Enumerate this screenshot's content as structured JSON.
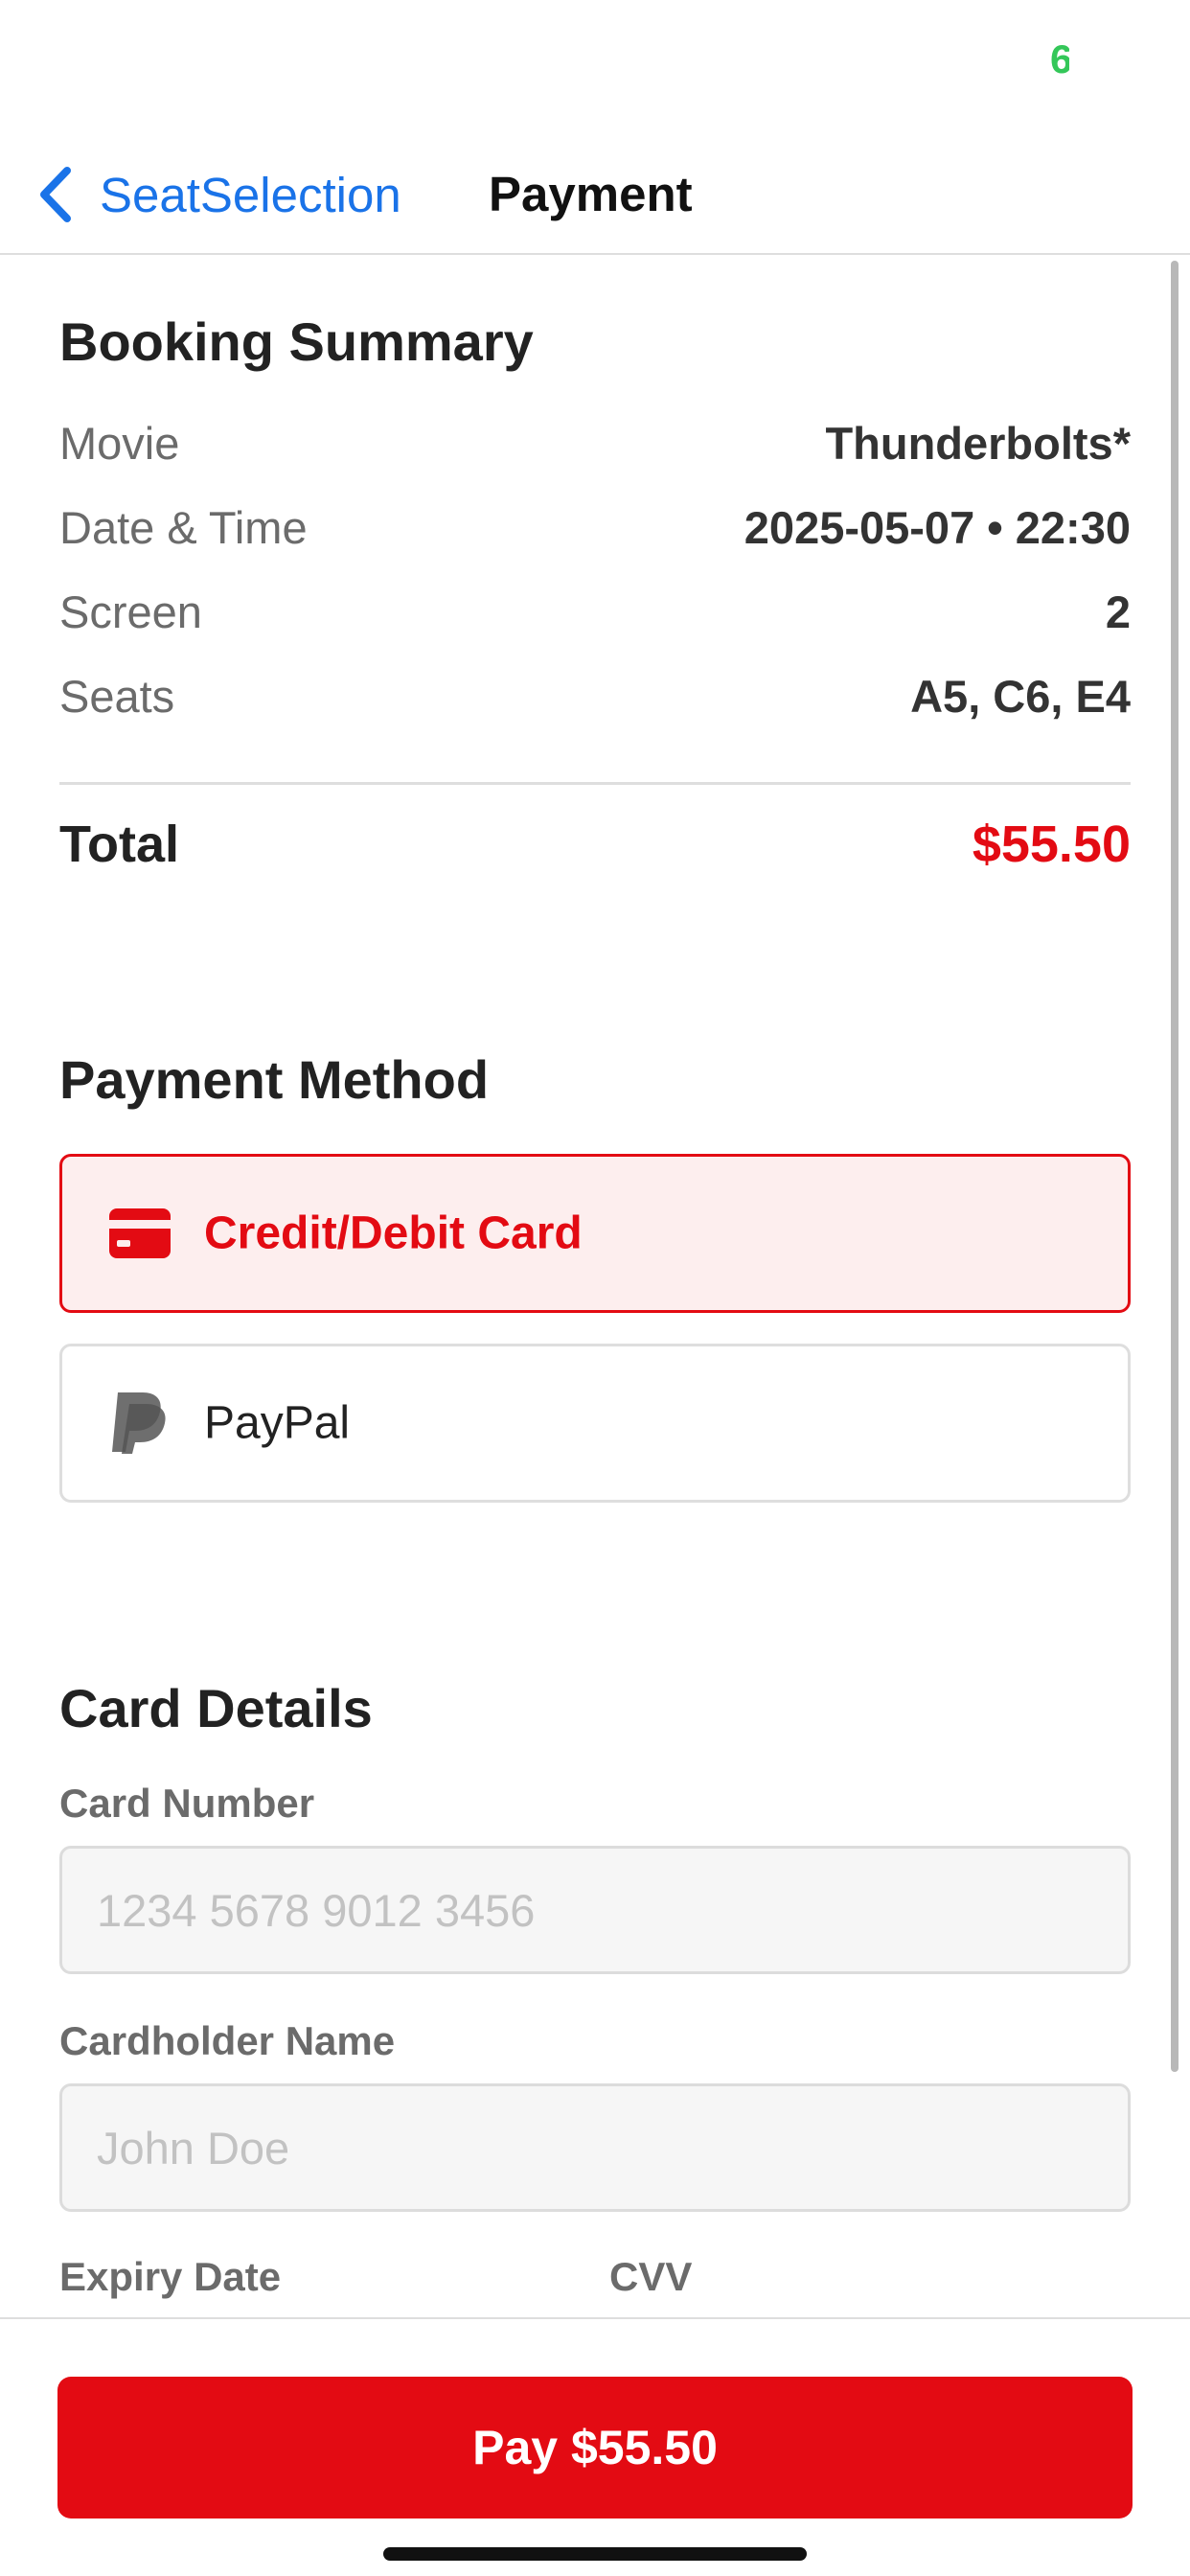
{
  "status": {
    "battery_glyph": "6"
  },
  "nav": {
    "back_label": "SeatSelection",
    "title": "Payment"
  },
  "booking_summary": {
    "title": "Booking Summary",
    "rows": [
      {
        "label": "Movie",
        "value": "Thunderbolts*"
      },
      {
        "label": "Date & Time",
        "value": "2025-05-07 • 22:30"
      },
      {
        "label": "Screen",
        "value": "2"
      },
      {
        "label": "Seats",
        "value": "A5, C6, E4"
      }
    ],
    "total_label": "Total",
    "total_value": "$55.50"
  },
  "payment_method": {
    "title": "Payment Method",
    "options": [
      {
        "label": "Credit/Debit Card",
        "icon": "credit-card-icon",
        "selected": true
      },
      {
        "label": "PayPal",
        "icon": "paypal-icon",
        "selected": false
      }
    ]
  },
  "card_details": {
    "title": "Card Details",
    "card_number_label": "Card Number",
    "card_number_placeholder": "1234 5678 9012 3456",
    "cardholder_label": "Cardholder Name",
    "cardholder_placeholder": "John Doe",
    "expiry_label": "Expiry Date",
    "cvv_label": "CVV"
  },
  "footer": {
    "pay_label": "Pay $55.50"
  },
  "colors": {
    "accent": "#e30b13",
    "link": "#1a73e8",
    "battery": "#34c759"
  }
}
